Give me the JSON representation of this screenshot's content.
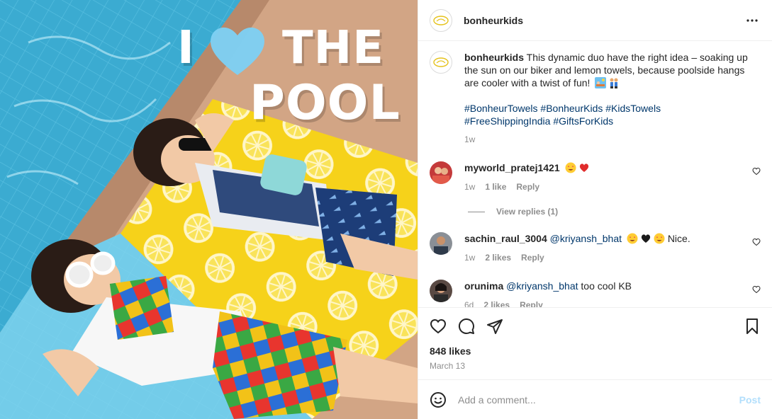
{
  "photo": {
    "headline_line1_left": "I",
    "headline_line1_right": "THE",
    "headline_line2": "POOL"
  },
  "post": {
    "username": "bonheurkids",
    "caption_username": "bonheurkids",
    "caption_text": "This dynamic duo have the right idea – soaking up the sun on our biker and lemon towels, because poolside hangs are cooler with a twist of fun!",
    "caption_emojis": [
      "sunbather-emoji",
      "boys-holding-hands-emoji"
    ],
    "hashtags": [
      "#BonheurTowels",
      "#BonheurKids",
      "#KidsTowels",
      "#FreeShippingIndia",
      "#GiftsForKids"
    ],
    "caption_time": "1w"
  },
  "comments": [
    {
      "username": "myworld_pratej1421",
      "text": "",
      "emojis": [
        "star-struck-emoji",
        "red-heart-emoji"
      ],
      "time": "1w",
      "likes": "1 like",
      "reply_label": "Reply",
      "view_replies": "View replies (1)"
    },
    {
      "username": "sachin_raul_3004",
      "mention": "@kriyansh_bhat",
      "emojis": [
        "star-struck-emoji",
        "black-heart-emoji",
        "star-struck-emoji"
      ],
      "text": "Nice.",
      "time": "1w",
      "likes": "2 likes",
      "reply_label": "Reply"
    },
    {
      "username": "orunima",
      "mention": "@kriyansh_bhat",
      "text": "too cool KB",
      "time": "6d",
      "likes": "2 likes",
      "reply_label": "Reply"
    }
  ],
  "stats": {
    "likes": "848 likes",
    "date": "March 13"
  },
  "comment_input": {
    "placeholder": "Add a comment...",
    "post_label": "Post"
  },
  "colors": {
    "link": "#00376b",
    "muted": "#8e8e8e",
    "post_disabled": "#b2dffc",
    "headline_heart": "#7ecff3"
  }
}
